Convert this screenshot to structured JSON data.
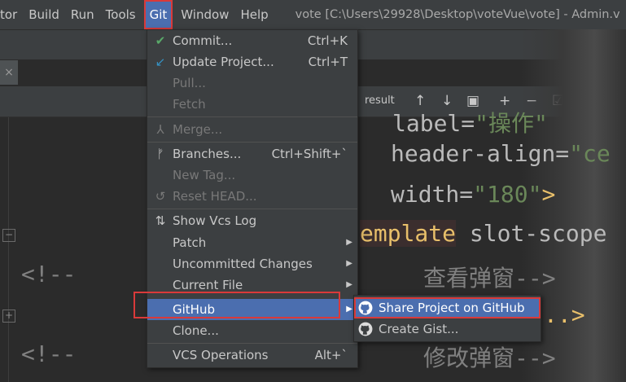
{
  "menubar": {
    "items": [
      "tor",
      "Build",
      "Run",
      "Tools",
      "Git",
      "Window",
      "Help"
    ],
    "title": "vote [C:\\Users\\29928\\Desktop\\voteVue\\vote] - Admin.v"
  },
  "tab": {
    "close": "×"
  },
  "toolbar": {
    "result_label": "result"
  },
  "editor": {
    "line1": {
      "attr": "label=",
      "str": "\"操作\""
    },
    "line2": {
      "attr": "header-align=",
      "str": "\"ce"
    },
    "line3": {
      "attr": "width=",
      "str": "\"180\"",
      "punct": ">"
    },
    "line4": {
      "tag": "emplate",
      "rest": " slot-scope"
    },
    "line5": {
      "comment": "查看弹窗-->"
    },
    "line6": {
      "punct": "..>"
    },
    "line7": {
      "comment": "修改弹窗-->"
    },
    "comment_open": "<!--"
  },
  "git_menu": {
    "commit": {
      "label": "Commit...",
      "shortcut": "Ctrl+K"
    },
    "update": {
      "label": "Update Project...",
      "shortcut": "Ctrl+T"
    },
    "pull": {
      "label": "Pull..."
    },
    "fetch": {
      "label": "Fetch"
    },
    "merge": {
      "label": "Merge..."
    },
    "branches": {
      "label": "Branches...",
      "shortcut": "Ctrl+Shift+`"
    },
    "new_tag": {
      "label": "New Tag..."
    },
    "reset_head": {
      "label": "Reset HEAD..."
    },
    "show_log": {
      "label": "Show Vcs Log"
    },
    "patch": {
      "label": "Patch"
    },
    "uncommitted": {
      "label": "Uncommitted Changes"
    },
    "current_file": {
      "label": "Current File"
    },
    "github": {
      "label": "GitHub"
    },
    "clone": {
      "label": "Clone..."
    },
    "vcs_ops": {
      "label": "VCS Operations",
      "shortcut": "Alt+`"
    }
  },
  "github_submenu": {
    "share": {
      "label": "Share Project on GitHub"
    },
    "gist": {
      "label": "Create Gist..."
    }
  },
  "colors": {
    "menu_bg": "#3c3f41",
    "selection": "#4b6eaf",
    "highlight_box": "#d93a3a",
    "editor_bg": "#2b2b2b"
  }
}
